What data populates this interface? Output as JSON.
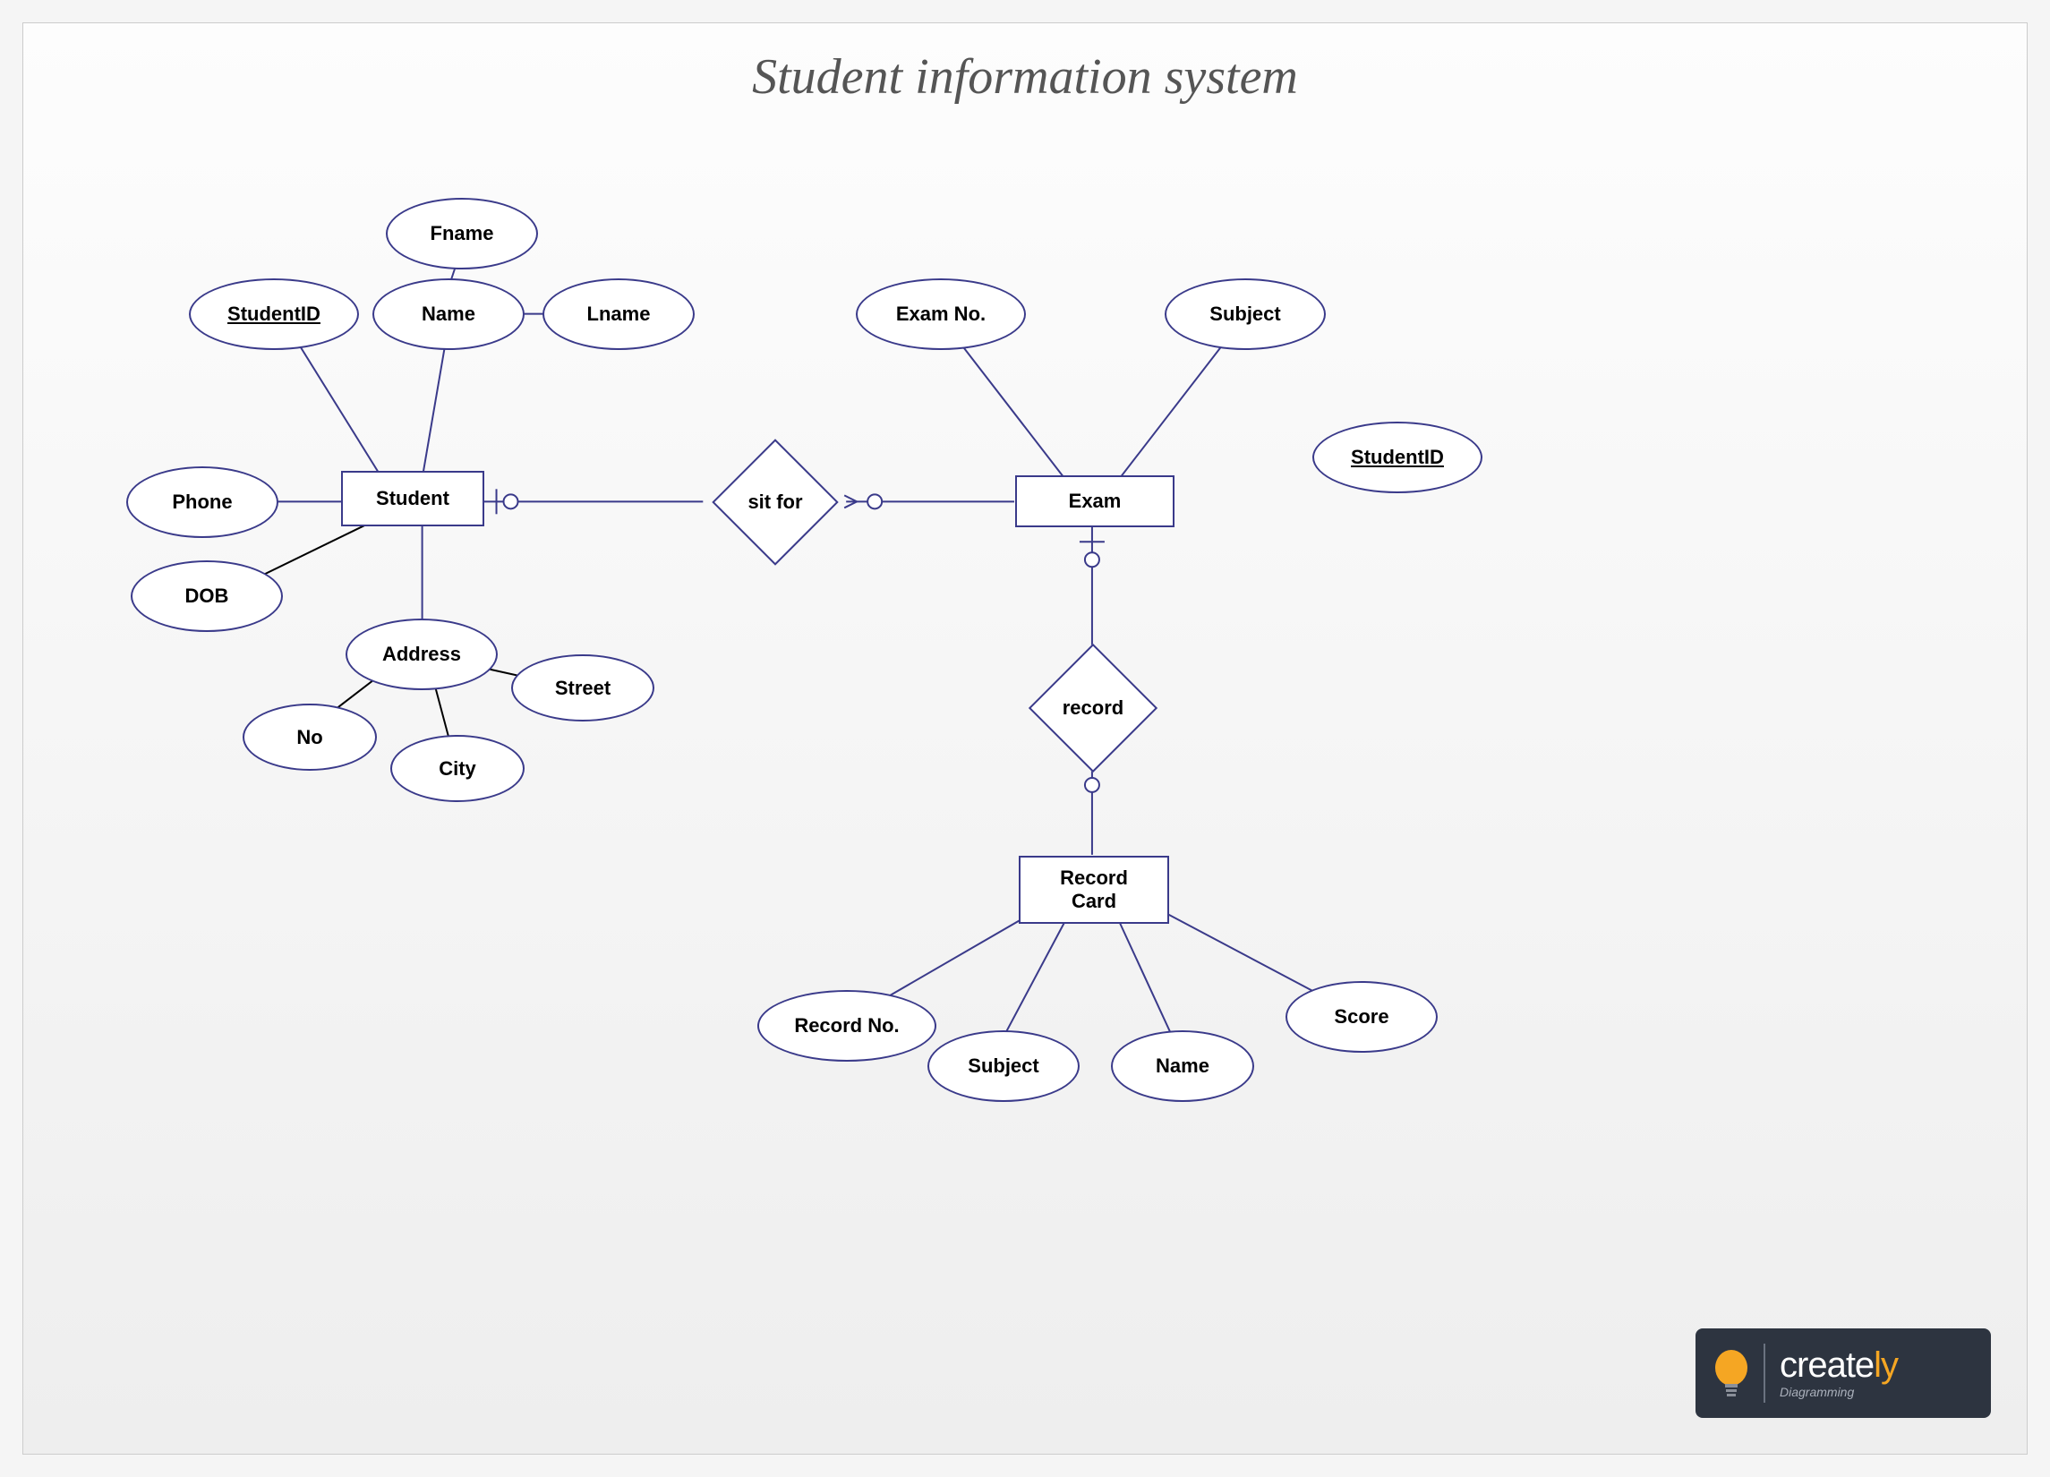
{
  "title": "Student information system",
  "entities": {
    "student": "Student",
    "exam": "Exam",
    "recordcard_l1": "Record",
    "recordcard_l2": "Card"
  },
  "relationships": {
    "sitfor": "sit for",
    "record": "record"
  },
  "attributes": {
    "fname": "Fname",
    "lname": "Lname",
    "name": "Name",
    "studentid": "StudentID",
    "phone": "Phone",
    "dob": "DOB",
    "address": "Address",
    "no": "No",
    "city": "City",
    "street": "Street",
    "examno": "Exam No.",
    "subject_exam": "Subject",
    "studentid2": "StudentID",
    "recordno": "Record No.",
    "subject_rc": "Subject",
    "name_rc": "Name",
    "score": "Score"
  },
  "logo": {
    "brand_prefix": "create",
    "brand_suffix": "ly",
    "tagline": "Diagramming"
  }
}
